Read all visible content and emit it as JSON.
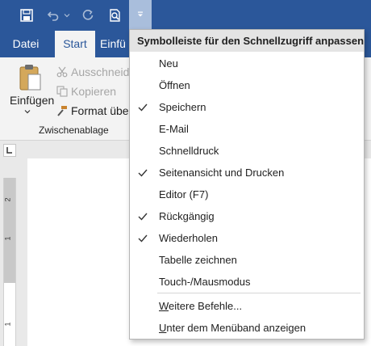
{
  "colors": {
    "accent": "#2b579a",
    "menu_bg": "#ffffff",
    "header_bg": "#e4e4e4",
    "active_qat": "#a9bedc"
  },
  "qat": {
    "save_icon": "save-icon",
    "undo_icon": "undo-icon",
    "redo_icon": "redo-icon",
    "print_preview_icon": "print-preview-icon",
    "customize_icon": "customize-dropdown-icon"
  },
  "tabs": [
    {
      "label": "Datei"
    },
    {
      "label": "Start"
    },
    {
      "label": "Einfü"
    }
  ],
  "ribbon": {
    "paste_label": "Einfügen",
    "cut_label": "Ausschneide",
    "copy_label": "Kopieren",
    "format_painter_label": "Format über",
    "group_label": "Zwischenablage"
  },
  "vruler_labels": [
    "2",
    "1",
    "1"
  ],
  "menu": {
    "header": "Symbolleiste für den Schnellzugriff anpassen",
    "items": [
      {
        "label": "Neu",
        "checked": false
      },
      {
        "label": "Öffnen",
        "checked": false
      },
      {
        "label": "Speichern",
        "checked": true
      },
      {
        "label": "E-Mail",
        "checked": false
      },
      {
        "label": "Schnelldruck",
        "checked": false
      },
      {
        "label": "Seitenansicht und Drucken",
        "checked": true
      },
      {
        "label": "Editor (F7)",
        "checked": false
      },
      {
        "label": "Rückgängig",
        "checked": true
      },
      {
        "label": "Wiederholen",
        "checked": true
      },
      {
        "label": "Tabelle zeichnen",
        "checked": false
      },
      {
        "label": "Touch-/Mausmodus",
        "checked": false
      }
    ],
    "more_commands": {
      "accel": "W",
      "rest": "eitere Befehle..."
    },
    "show_below": {
      "accel": "U",
      "rest": "nter dem Menüband anzeigen"
    }
  }
}
